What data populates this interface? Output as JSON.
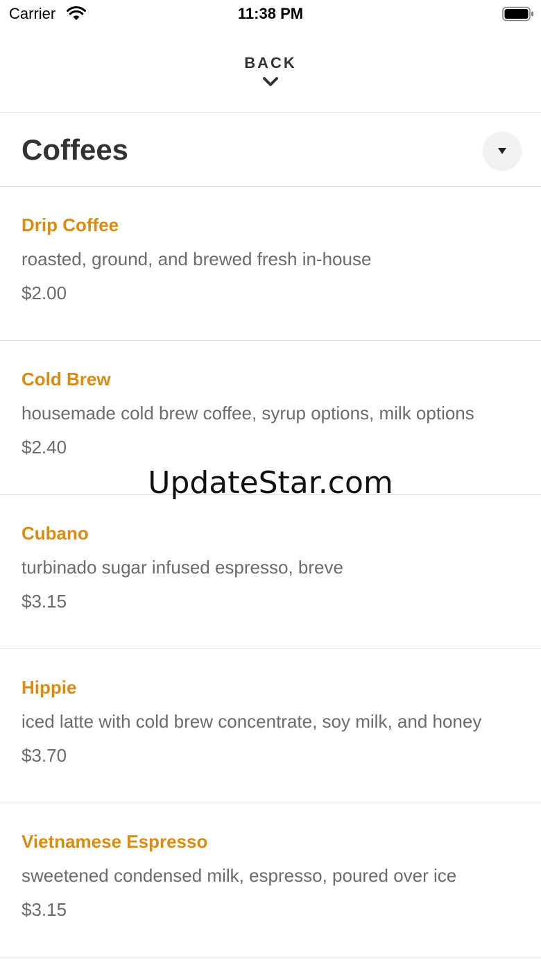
{
  "status_bar": {
    "carrier": "Carrier",
    "time": "11:38 PM"
  },
  "nav": {
    "back_label": "BACK"
  },
  "section": {
    "title": "Coffees"
  },
  "items": [
    {
      "name": "Drip Coffee",
      "description": "roasted, ground, and brewed fresh in-house",
      "price": "$2.00"
    },
    {
      "name": "Cold Brew",
      "description": "housemade cold brew coffee, syrup options, milk options",
      "price": "$2.40"
    },
    {
      "name": "Cubano",
      "description": "turbinado sugar infused espresso, breve",
      "price": "$3.15"
    },
    {
      "name": "Hippie",
      "description": "iced latte with cold brew concentrate, soy milk, and honey",
      "price": "$3.70"
    },
    {
      "name": "Vietnamese Espresso",
      "description": "sweetened condensed milk, espresso, poured over ice",
      "price": "$3.15"
    }
  ],
  "watermark": "UpdateStar.com",
  "colors": {
    "accent": "#d98b12",
    "text_primary": "#333333",
    "text_secondary": "#6b6b6b",
    "divider": "#e3e3e3"
  }
}
